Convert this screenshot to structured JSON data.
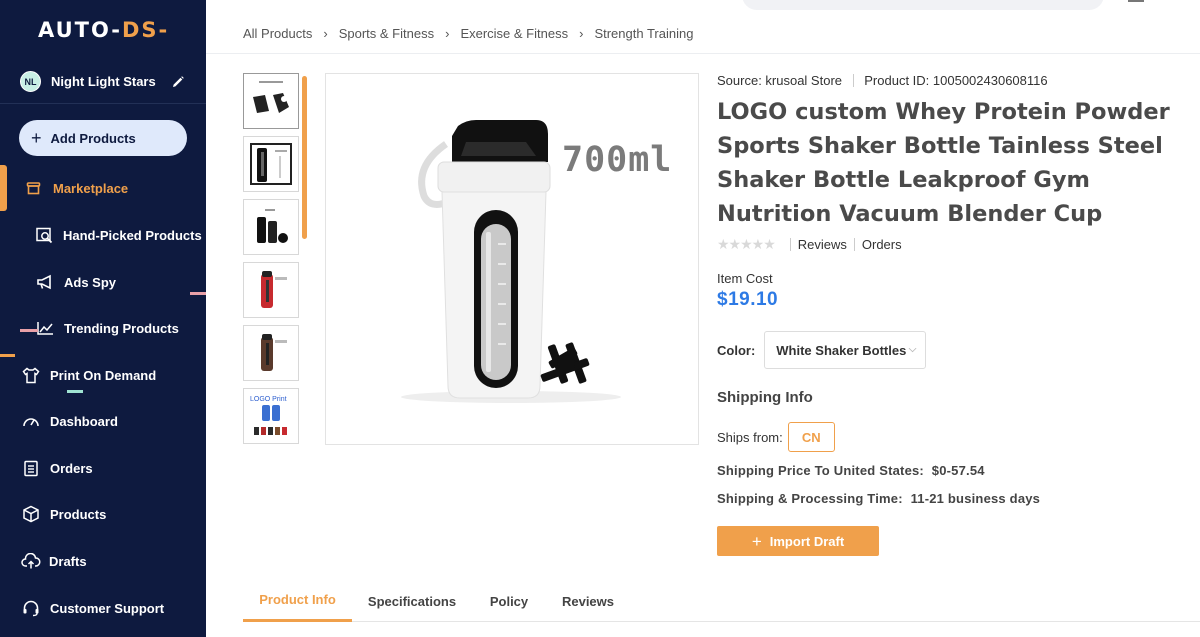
{
  "brand": {
    "logo_left": "AUTO-",
    "logo_right": "DS-"
  },
  "user": {
    "initials": "NL",
    "name": "Night Light Stars"
  },
  "sidebar": {
    "add_button": "Add Products",
    "items": [
      {
        "label": "Marketplace",
        "icon": "store-icon"
      },
      {
        "label": "Hand-Picked Products",
        "icon": "search-product-icon"
      },
      {
        "label": "Ads Spy",
        "icon": "megaphone-icon"
      },
      {
        "label": "Trending Products",
        "icon": "trending-chart-icon"
      },
      {
        "label": "Print On Demand",
        "icon": "tshirt-icon"
      },
      {
        "label": "Dashboard",
        "icon": "gauge-icon"
      },
      {
        "label": "Orders",
        "icon": "clipboard-icon"
      },
      {
        "label": "Products",
        "icon": "box-icon"
      },
      {
        "label": "Drafts",
        "icon": "cloud-upload-icon"
      },
      {
        "label": "Customer Support",
        "icon": "headset-icon"
      }
    ]
  },
  "breadcrumb": [
    "All Products",
    "Sports & Fitness",
    "Exercise & Fitness",
    "Strength Training"
  ],
  "gallery": {
    "main_image_label": "700ml",
    "thumb_logo_text": "LOGO Print"
  },
  "product": {
    "source_label": "Source: krusoal Store",
    "product_id_label": "Product ID: 1005002430608116",
    "title": "LOGO custom Whey Protein Powder Sports Shaker Bottle Tainless Steel Shaker Bottle Leakproof Gym Nutrition Vacuum Blender Cup",
    "reviews_label": "Reviews",
    "orders_label": "Orders",
    "rating_stars": 0,
    "item_cost_label": "Item Cost",
    "price": "$19.10",
    "color_label": "Color:",
    "color_value": "White Shaker Bottles",
    "shipping_info_title": "Shipping Info",
    "ships_from_label": "Ships from:",
    "ships_from_value": "CN",
    "shipping_price_label": "Shipping Price To United States:",
    "shipping_price_value": "$0-57.54",
    "processing_time_label": "Shipping & Processing Time:",
    "processing_time_value": "11-21 business days",
    "import_button": "Import Draft"
  },
  "tabs": [
    "Product Info",
    "Specifications",
    "Policy",
    "Reviews"
  ],
  "colors": {
    "sidebar_bg": "#0e1a3f",
    "accent": "#f0a04b",
    "price": "#2d7ae5"
  }
}
